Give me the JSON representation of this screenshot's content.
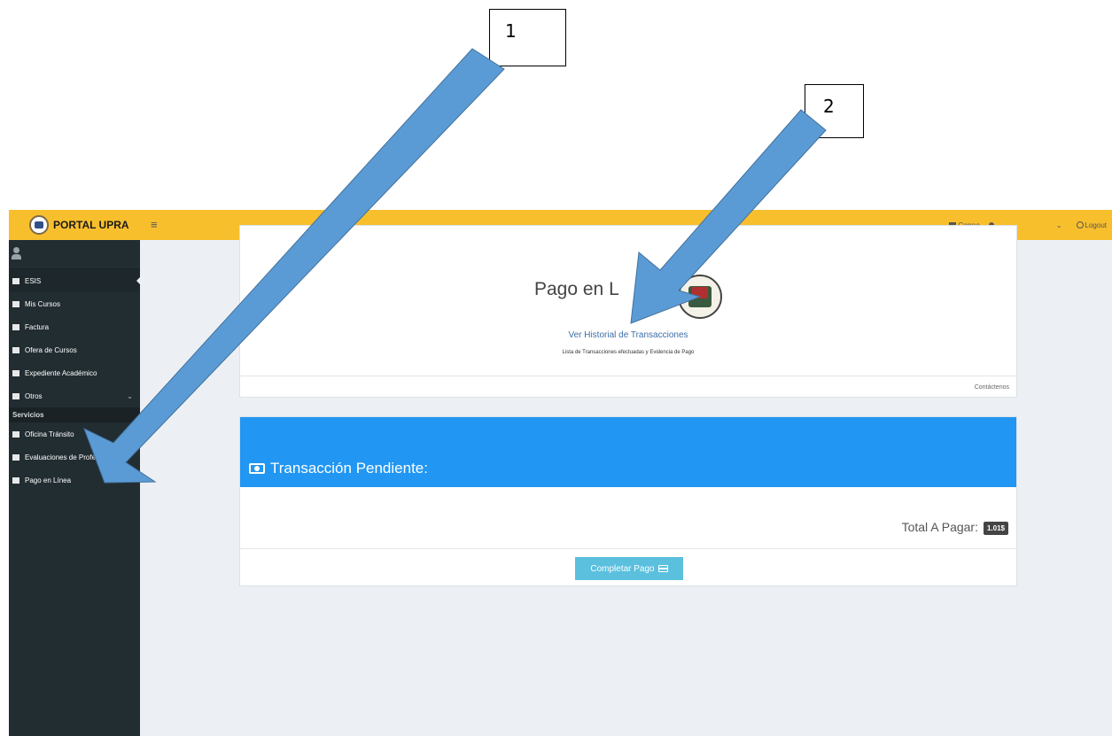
{
  "annotations": {
    "callout_1": "1",
    "callout_2": "2"
  },
  "header": {
    "brand": "PORTAL UPRA",
    "menu_icon": "≡",
    "mail_label": "Correo",
    "dropdown_caret": "⌄",
    "logout_label": "Logout"
  },
  "sidebar": {
    "items": [
      {
        "label": "ESIS",
        "icon": "dashboard-icon"
      },
      {
        "label": "Mis Cursos",
        "icon": "calendar-icon"
      },
      {
        "label": "Factura",
        "icon": "money-icon"
      },
      {
        "label": "Ofera de Cursos",
        "icon": "calendar-check-icon"
      },
      {
        "label": "Expediente Académico",
        "icon": "book-icon"
      },
      {
        "label": "Otros",
        "icon": "sitemap-icon",
        "chevron": "⌄"
      }
    ],
    "section_header": "Servicios",
    "services": [
      {
        "label": "Oficina Tránsito",
        "icon": "car-icon"
      },
      {
        "label": "Evaluaciones de Profe",
        "icon": "star-icon"
      },
      {
        "label": "Pago en Línea",
        "icon": "money-icon"
      }
    ]
  },
  "payment_card": {
    "title": "Pago en L",
    "history_link": "Ver Historial de Transacciones",
    "history_description": "Lista de Transacciones efectuadas y Evidencia de Pago",
    "contact": "Contáctenos"
  },
  "pending_card": {
    "title": "Transacción Pendiente:",
    "total_label": "Total A Pagar:",
    "total_value": "1.01$",
    "button_label": "Completar Pago"
  },
  "colors": {
    "topbar": "#f8bf2d",
    "sidebar": "#222d32",
    "header_band": "#2196f3",
    "button": "#5bc0de",
    "arrow": "#5b9bd5"
  }
}
